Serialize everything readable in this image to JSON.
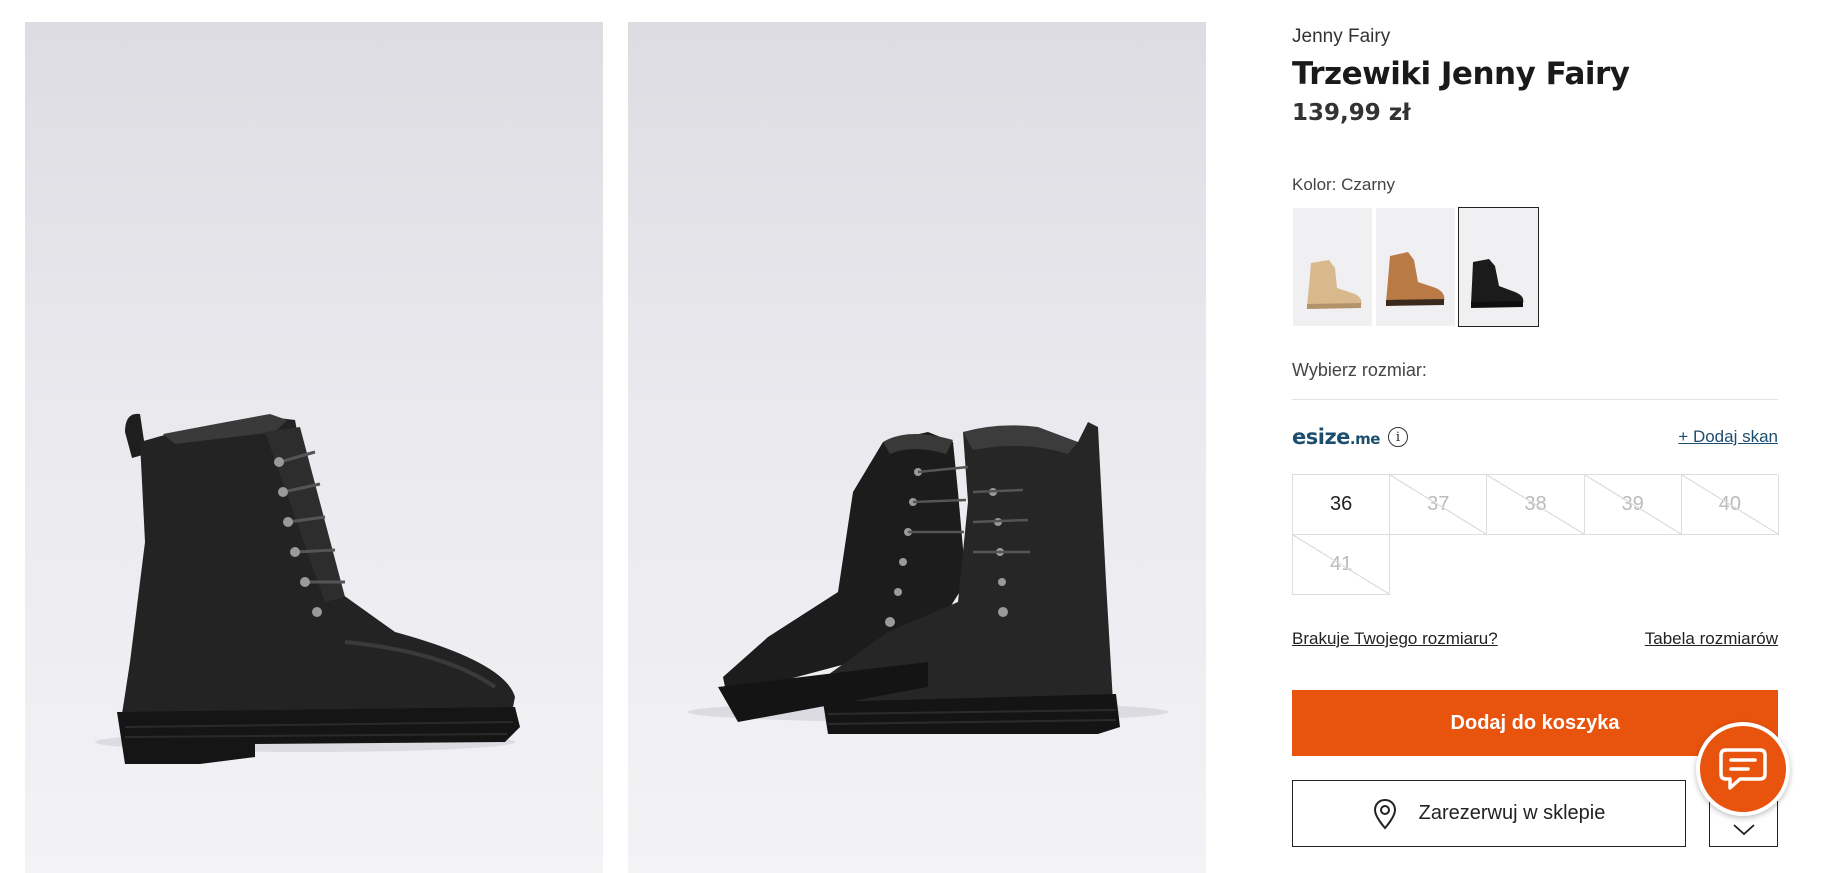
{
  "product": {
    "brand": "Jenny Fairy",
    "title": "Trzewiki Jenny Fairy",
    "price": "139,99 zł"
  },
  "color": {
    "label": "Kolor: Czarny",
    "swatches": [
      {
        "name": "beige",
        "hex": "#d8b98e",
        "selected": false
      },
      {
        "name": "brown",
        "hex": "#b97a45",
        "selected": false
      },
      {
        "name": "black",
        "hex": "#1b1b1b",
        "selected": true
      }
    ]
  },
  "size": {
    "label": "Wybierz rozmiar:",
    "esize_logo": "esize",
    "esize_suffix": ".me",
    "add_scan": "+ Dodaj skan",
    "options": [
      {
        "value": "36",
        "available": true
      },
      {
        "value": "37",
        "available": false
      },
      {
        "value": "38",
        "available": false
      },
      {
        "value": "39",
        "available": false
      },
      {
        "value": "40",
        "available": false
      },
      {
        "value": "41",
        "available": false
      }
    ],
    "missing_link": "Brakuje Twojego rozmiaru?",
    "table_link": "Tabela rozmiarów"
  },
  "actions": {
    "add_to_cart": "Dodaj do koszyka",
    "reserve": "Zarezerwuj w sklepie"
  },
  "icons": {
    "info": "info-icon",
    "location": "location-pin-icon",
    "chevron": "chevron-down-icon",
    "chat": "chat-icon"
  },
  "colors": {
    "accent": "#e8530e",
    "esize": "#1d4e6e"
  }
}
